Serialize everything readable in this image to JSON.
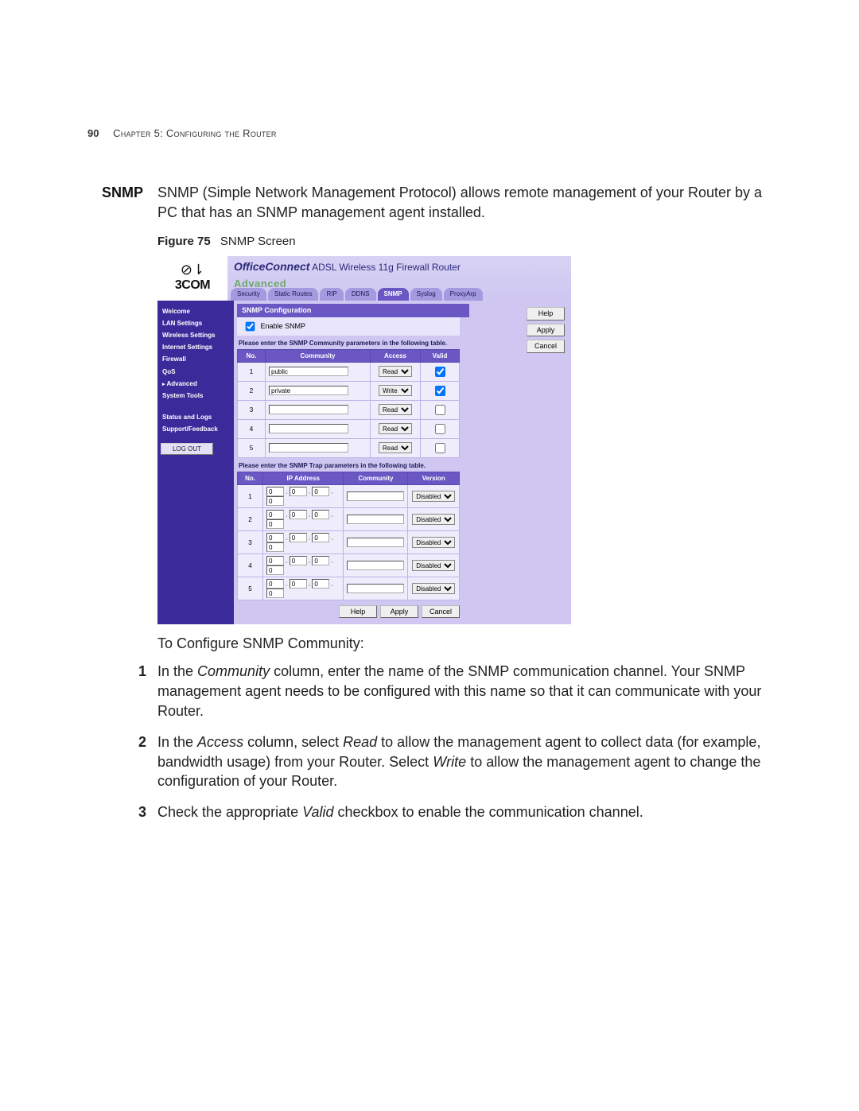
{
  "page": {
    "number": "90",
    "chapter_line": "Chapter 5: Configuring the Router"
  },
  "section": {
    "heading": "SNMP",
    "intro": "SNMP (Simple Network Management Protocol) allows remote management of your Router by a PC that has an SNMP management agent installed."
  },
  "figure": {
    "label": "Figure 75",
    "caption": "SNMP Screen"
  },
  "router_ui": {
    "logo_glyph": "⊘⇂",
    "logo_text": "3COM",
    "brand_prefix": "OfficeConnect",
    "brand_suffix": "ADSL Wireless 11g Firewall Router",
    "page_title": "Advanced",
    "tabs": [
      "Security",
      "Static Routes",
      "RIP",
      "DDNS",
      "SNMP",
      "Syslog",
      "ProxyArp"
    ],
    "active_tab_index": 4,
    "sidebar": {
      "items": [
        {
          "label": "Welcome",
          "bold": true
        },
        {
          "label": "LAN Settings",
          "bold": true
        },
        {
          "label": "Wireless Settings",
          "bold": true
        },
        {
          "label": "Internet Settings",
          "bold": true
        },
        {
          "label": "Firewall",
          "bold": true
        },
        {
          "label": "QoS",
          "bold": true
        },
        {
          "label": "Advanced",
          "bold": true,
          "active": true
        },
        {
          "label": "System Tools",
          "bold": true
        }
      ],
      "items2": [
        {
          "label": "Status and Logs",
          "bold": true
        },
        {
          "label": "Support/Feedback",
          "bold": true
        }
      ],
      "logout_label": "LOG OUT"
    },
    "side_buttons": {
      "help": "Help",
      "apply": "Apply",
      "cancel": "Cancel"
    },
    "panel_title": "SNMP Configuration",
    "enable_label": "Enable SNMP",
    "enable_checked": true,
    "community_instruction": "Please enter the SNMP Community parameters in the following table.",
    "community_headers": {
      "no": "No.",
      "community": "Community",
      "access": "Access",
      "valid": "Valid"
    },
    "access_options": [
      "Read",
      "Write"
    ],
    "community_rows": [
      {
        "no": "1",
        "community": "public",
        "access": "Read",
        "valid": true
      },
      {
        "no": "2",
        "community": "private",
        "access": "Write",
        "valid": true
      },
      {
        "no": "3",
        "community": "",
        "access": "Read",
        "valid": false
      },
      {
        "no": "4",
        "community": "",
        "access": "Read",
        "valid": false
      },
      {
        "no": "5",
        "community": "",
        "access": "Read",
        "valid": false
      }
    ],
    "trap_instruction": "Please enter the SNMP Trap parameters in the following table.",
    "trap_headers": {
      "no": "No.",
      "ip": "IP Address",
      "community": "Community",
      "version": "Version"
    },
    "version_options": [
      "Disabled"
    ],
    "trap_rows": [
      {
        "no": "1",
        "ip": [
          "0",
          "0",
          "0",
          "0"
        ],
        "community": "",
        "version": "Disabled"
      },
      {
        "no": "2",
        "ip": [
          "0",
          "0",
          "0",
          "0"
        ],
        "community": "",
        "version": "Disabled"
      },
      {
        "no": "3",
        "ip": [
          "0",
          "0",
          "0",
          "0"
        ],
        "community": "",
        "version": "Disabled"
      },
      {
        "no": "4",
        "ip": [
          "0",
          "0",
          "0",
          "0"
        ],
        "community": "",
        "version": "Disabled"
      },
      {
        "no": "5",
        "ip": [
          "0",
          "0",
          "0",
          "0"
        ],
        "community": "",
        "version": "Disabled"
      }
    ],
    "footer_buttons": {
      "help": "Help",
      "apply": "Apply",
      "cancel": "Cancel"
    }
  },
  "post_figure_line": "To Configure SNMP Community:",
  "steps": [
    {
      "pre": "In the ",
      "em1": "Community",
      "mid": " column, enter the name of the SNMP communication channel. Your SNMP management agent needs to be configured with this name so that it can communicate with your Router."
    },
    {
      "pre": "In the ",
      "em1": "Access",
      "mid": " column, select ",
      "em2": "Read",
      "mid2": " to allow the management agent to collect data (for example, bandwidth usage) from your Router. Select ",
      "em3": "Write",
      "mid3": " to allow the management agent to change the configuration of your Router."
    },
    {
      "pre": "Check the appropriate ",
      "em1": "Valid",
      "mid": " checkbox to enable the communication channel."
    }
  ]
}
